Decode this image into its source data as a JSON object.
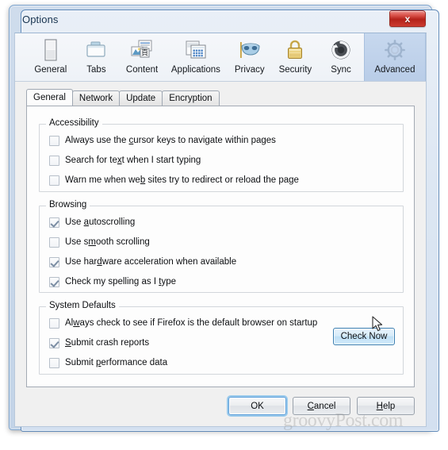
{
  "window": {
    "title": "Options",
    "close_label": "x"
  },
  "toolbar": {
    "items": [
      {
        "label": "General",
        "icon": "general-icon"
      },
      {
        "label": "Tabs",
        "icon": "tabs-icon"
      },
      {
        "label": "Content",
        "icon": "content-icon"
      },
      {
        "label": "Applications",
        "icon": "applications-icon"
      },
      {
        "label": "Privacy",
        "icon": "privacy-mask-icon"
      },
      {
        "label": "Security",
        "icon": "security-padlock-icon"
      },
      {
        "label": "Sync",
        "icon": "sync-icon"
      },
      {
        "label": "Advanced",
        "icon": "advanced-gear-icon"
      }
    ],
    "selected": "Advanced"
  },
  "tabs": {
    "items": [
      {
        "label": "General"
      },
      {
        "label": "Network"
      },
      {
        "label": "Update"
      },
      {
        "label": "Encryption"
      }
    ],
    "active": "General"
  },
  "groups": {
    "accessibility": {
      "title": "Accessibility",
      "options": [
        {
          "pre": "Always use the ",
          "key": "c",
          "post": "ursor keys to navigate within pages",
          "checked": false
        },
        {
          "pre": "Search for te",
          "key": "x",
          "post": "t when I start typing",
          "checked": false
        },
        {
          "pre": "Warn me when we",
          "key": "b",
          "post": " sites try to redirect or reload the page",
          "checked": false
        }
      ]
    },
    "browsing": {
      "title": "Browsing",
      "options": [
        {
          "pre": "Use ",
          "key": "a",
          "post": "utoscrolling",
          "checked": true
        },
        {
          "pre": "Use s",
          "key": "m",
          "post": "ooth scrolling",
          "checked": false
        },
        {
          "pre": "Use har",
          "key": "d",
          "post": "ware acceleration when available",
          "checked": true
        },
        {
          "pre": "Check my spelling as I ",
          "key": "t",
          "post": "ype",
          "checked": true
        }
      ]
    },
    "system_defaults": {
      "title": "System Defaults",
      "options": [
        {
          "pre": "Al",
          "key": "w",
          "post": "ays check to see if Firefox is the default browser on startup",
          "checked": false
        },
        {
          "pre": "",
          "key": "S",
          "post": "ubmit crash reports",
          "checked": true
        },
        {
          "pre": "Submit ",
          "key": "p",
          "post": "erformance data",
          "checked": false
        }
      ],
      "check_now_label": "Check Now"
    }
  },
  "footer": {
    "ok_label": "OK",
    "cancel_pre": "",
    "cancel_key": "C",
    "cancel_post": "ancel",
    "help_pre": "",
    "help_key": "H",
    "help_post": "elp"
  },
  "watermark": "groovyPost.com",
  "colors": {
    "accent": "#3c7fb1",
    "selected_tab_bg": "#bdd1ea",
    "close_red": "#b4221a"
  }
}
